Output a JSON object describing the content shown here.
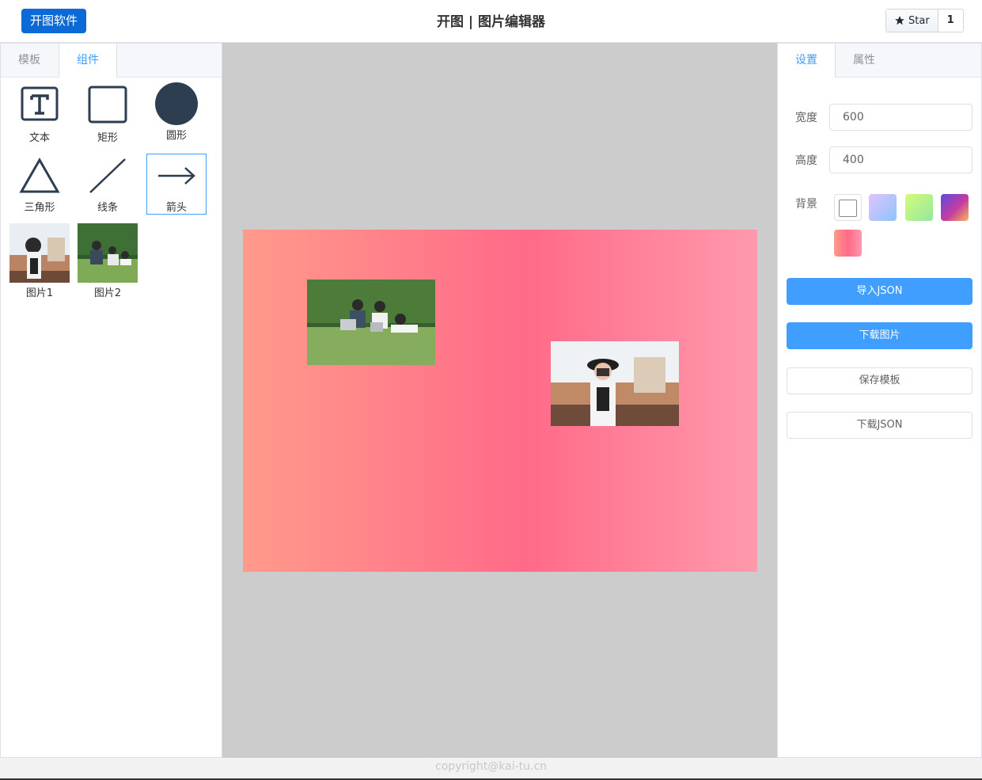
{
  "header": {
    "brand_label": "开图软件",
    "title": "开图 | 图片编辑器",
    "star_label": "Star",
    "star_count": "1"
  },
  "left_panel": {
    "tabs": [
      {
        "label": "模板",
        "active": false
      },
      {
        "label": "组件",
        "active": true
      }
    ],
    "components": [
      {
        "label": "文本",
        "icon": "text-icon"
      },
      {
        "label": "矩形",
        "icon": "rectangle-icon"
      },
      {
        "label": "圆形",
        "icon": "circle-icon"
      },
      {
        "label": "三角形",
        "icon": "triangle-icon"
      },
      {
        "label": "线条",
        "icon": "line-icon"
      },
      {
        "label": "箭头",
        "icon": "arrow-icon",
        "selected": true
      }
    ],
    "images": [
      {
        "label": "图片1"
      },
      {
        "label": "图片2"
      }
    ]
  },
  "canvas": {
    "gradient": [
      "#ff9a8b",
      "#ff6a88",
      "#ff99ac"
    ]
  },
  "right_panel": {
    "tabs": [
      {
        "label": "设置",
        "active": true
      },
      {
        "label": "属性",
        "active": false
      }
    ],
    "width_label": "宽度",
    "width_value": "600",
    "height_label": "高度",
    "height_value": "400",
    "background_label": "背景",
    "background_swatches": [
      "#ffffff",
      "gradient-lavender-blue",
      "gradient-green-yellow",
      "gradient-purple-orange",
      "gradient-pink"
    ],
    "buttons": {
      "import_json": "导入JSON",
      "download_image": "下载图片",
      "save_template": "保存模板",
      "download_json": "下载JSON"
    }
  },
  "footer": {
    "copyright": "copyright@kai-tu.cn"
  }
}
